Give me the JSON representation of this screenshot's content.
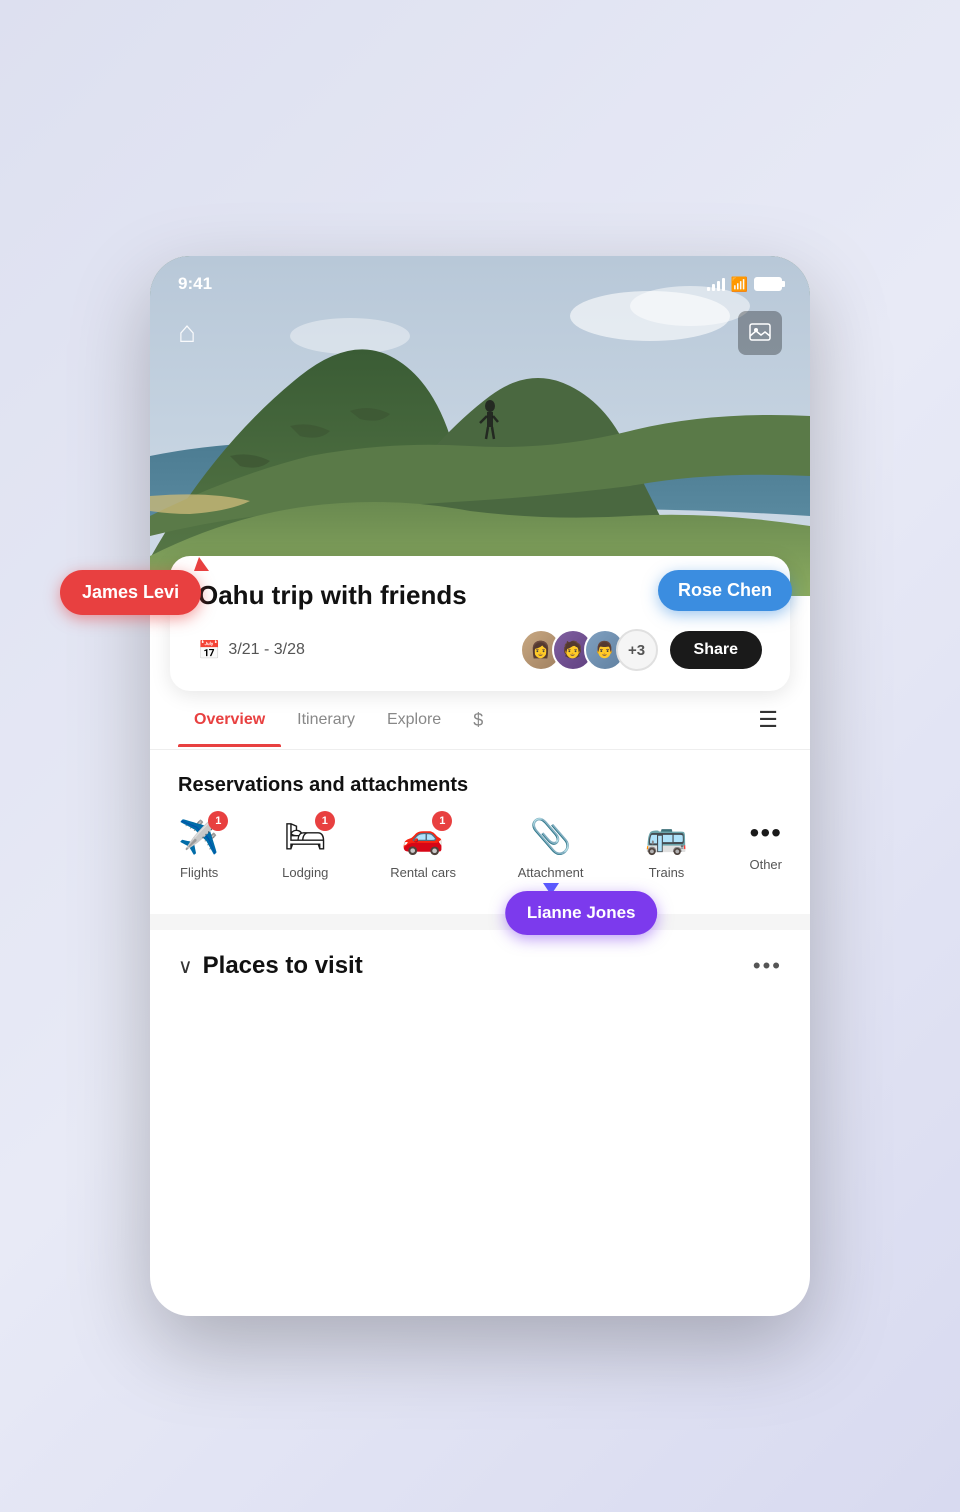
{
  "status": {
    "time": "9:41",
    "signal_label": "signal",
    "wifi_label": "wifi",
    "battery_label": "battery"
  },
  "hero": {
    "home_icon": "⌂",
    "gallery_icon": "🖼"
  },
  "trip": {
    "title": "Oahu trip with friends",
    "cursor_visible": true,
    "date_range": "3/21 - 3/28",
    "avatar_count": "+3",
    "share_label": "Share"
  },
  "tooltips": {
    "rose_chen": "Rose Chen",
    "james_levi": "James Levi",
    "lianne_jones": "Lianne Jones"
  },
  "nav": {
    "tabs": [
      {
        "id": "overview",
        "label": "Overview",
        "active": true
      },
      {
        "id": "itinerary",
        "label": "Itinerary",
        "active": false
      },
      {
        "id": "explore",
        "label": "Explore",
        "active": false
      },
      {
        "id": "dollar",
        "label": "$",
        "active": false
      }
    ],
    "menu_icon": "☰"
  },
  "reservations": {
    "section_title": "Reservations and attachments",
    "items": [
      {
        "id": "flights",
        "label": "Flights",
        "icon": "✈",
        "badge": "1",
        "has_badge": true
      },
      {
        "id": "lodging",
        "label": "Lodging",
        "icon": "🛏",
        "badge": "1",
        "has_badge": true
      },
      {
        "id": "rental-cars",
        "label": "Rental cars",
        "icon": "🚗",
        "badge": "1",
        "has_badge": true
      },
      {
        "id": "attachment",
        "label": "Attachment",
        "icon": "📎",
        "badge": null,
        "has_badge": false
      },
      {
        "id": "trains",
        "label": "Trains",
        "icon": "🚌",
        "badge": null,
        "has_badge": false
      },
      {
        "id": "other",
        "label": "Other",
        "icon": "•••",
        "badge": null,
        "has_badge": false
      }
    ]
  },
  "places": {
    "title": "Places to visit",
    "chevron": "∨",
    "more_icon": "•••"
  }
}
